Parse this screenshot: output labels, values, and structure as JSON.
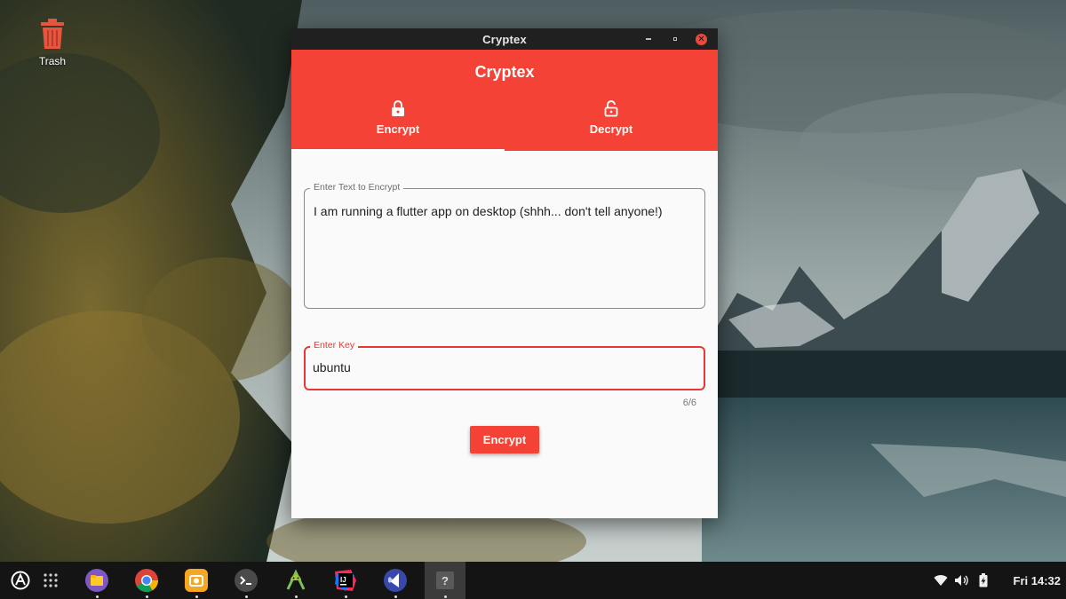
{
  "desktop": {
    "icons": [
      {
        "label": "Trash",
        "icon": "trash-icon",
        "color": "#e8553f"
      }
    ]
  },
  "window": {
    "title": "Cryptex",
    "controls": [
      "minimize-icon",
      "maximize-icon",
      "close-icon"
    ],
    "close_color": "#e94a3e"
  },
  "app": {
    "title": "Cryptex",
    "accent": "#f44336",
    "tabs": [
      {
        "label": "Encrypt",
        "icon": "lock-icon",
        "active": true
      },
      {
        "label": "Decrypt",
        "icon": "unlock-icon",
        "active": false
      }
    ],
    "text_field": {
      "label": "Enter Text to Encrypt",
      "value": "I am running a flutter app on desktop (shhh... don't tell anyone!)"
    },
    "key_field": {
      "label": "Enter Key",
      "value": "ubuntu",
      "counter": "6/6",
      "error_color": "#e53935"
    },
    "action_button": "Encrypt"
  },
  "taskbar": {
    "apps": [
      {
        "name": "app-grid-icon"
      },
      {
        "name": "files-icon",
        "running": true
      },
      {
        "name": "chrome-icon",
        "running": true
      },
      {
        "name": "screenshot-icon",
        "running": true
      },
      {
        "name": "terminal-icon",
        "running": true
      },
      {
        "name": "android-studio-icon",
        "running": true
      },
      {
        "name": "intellij-idea-icon",
        "running": true
      },
      {
        "name": "vscode-icon",
        "running": true
      },
      {
        "name": "unknown-app-icon",
        "running": true,
        "focused": true
      }
    ],
    "tray": [
      "wifi-icon",
      "volume-icon",
      "battery-charging-icon"
    ],
    "clock": "Fri 14:32"
  }
}
